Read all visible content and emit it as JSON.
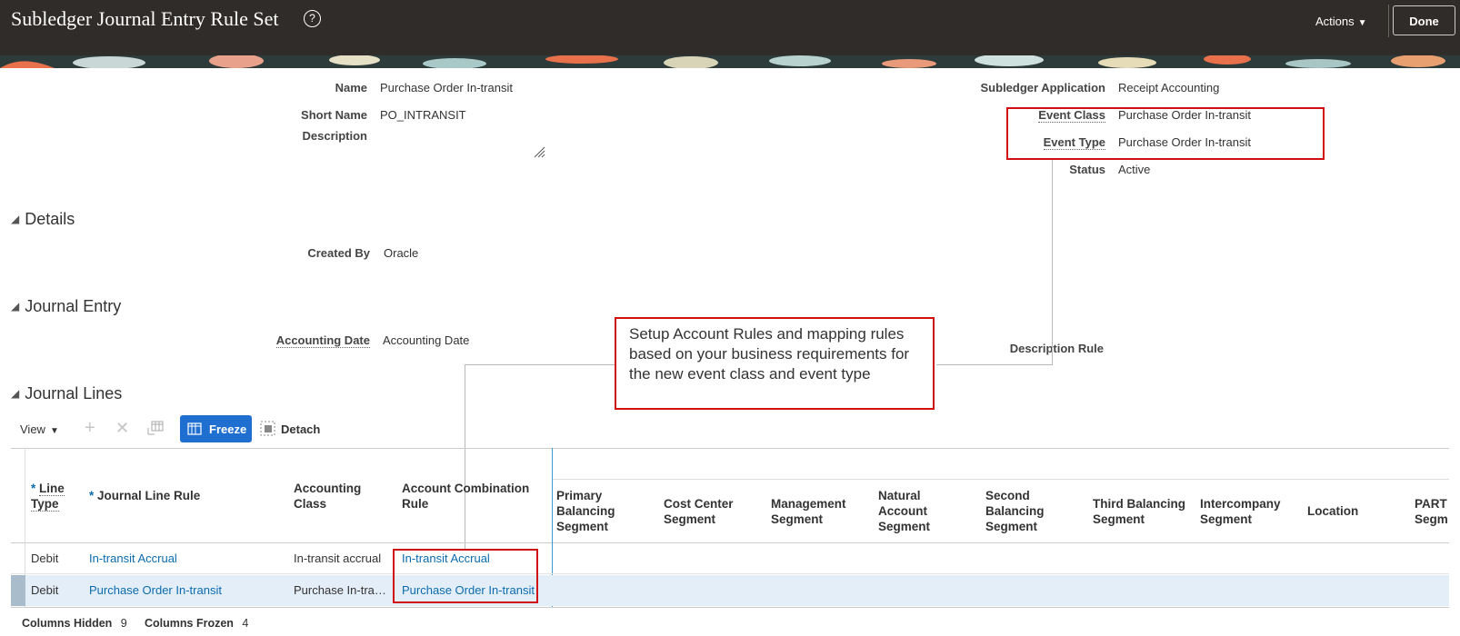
{
  "header": {
    "title": "Subledger Journal Entry Rule Set",
    "help_icon": "question-circle-icon",
    "actions_label": "Actions",
    "done_label": "Done"
  },
  "form": {
    "name_label": "Name",
    "name_value": "Purchase Order In-transit",
    "short_name_label": "Short Name",
    "short_name_value": "PO_INTRANSIT",
    "description_label": "Description",
    "description_value": "",
    "subledger_application_label": "Subledger Application",
    "subledger_application_value": "Receipt Accounting",
    "event_class_label": "Event Class",
    "event_class_value": "Purchase Order In-transit",
    "event_type_label": "Event Type",
    "event_type_value": "Purchase Order In-transit",
    "status_label": "Status",
    "status_value": "Active"
  },
  "details": {
    "title": "Details",
    "created_by_label": "Created By",
    "created_by_value": "Oracle"
  },
  "journal_entry": {
    "title": "Journal Entry",
    "accounting_date_label": "Accounting Date",
    "accounting_date_value": "Accounting Date",
    "description_rule_label": "Description Rule"
  },
  "callout": {
    "text": "Setup Account Rules and mapping rules based on your business requirements for the new event class and event type"
  },
  "journal_lines": {
    "title": "Journal Lines",
    "toolbar": {
      "view_label": "View",
      "add_icon": "plus-icon",
      "delete_icon": "x-icon",
      "columns_icon": "table-columns-icon",
      "freeze_label": "Freeze",
      "detach_label": "Detach"
    },
    "columns": {
      "line_type": "Line Type",
      "journal_line_rule": "Journal Line Rule",
      "accounting_class": "Accounting Class",
      "account_combination_rule": "Account Combination Rule",
      "primary_balancing_segment": "Primary Balancing Segment",
      "cost_center_segment": "Cost Center Segment",
      "management_segment": "Management Segment",
      "natural_account_segment": "Natural Account Segment",
      "second_balancing_segment": "Second Balancing Segment",
      "third_balancing_segment": "Third Balancing Segment",
      "intercompany_segment": "Intercompany Segment",
      "location": "Location",
      "partial": "PART Segm"
    },
    "rows": [
      {
        "line_type": "Debit",
        "journal_line_rule": "In-transit Accrual",
        "accounting_class": "In-transit accrual",
        "account_combination_rule": "In-transit Accrual"
      },
      {
        "line_type": "Debit",
        "journal_line_rule": "Purchase Order In-transit",
        "accounting_class": "Purchase In-tra…",
        "account_combination_rule": "Purchase Order In-transit"
      }
    ],
    "footer": {
      "columns_hidden_label": "Columns Hidden",
      "columns_hidden_value": "9",
      "columns_frozen_label": "Columns Frozen",
      "columns_frozen_value": "4"
    }
  },
  "colors": {
    "header_bg": "#302c29",
    "accent_blue": "#1f6fd1",
    "link_blue": "#0a6cad",
    "highlight_red": "#d01010",
    "selected_row": "#e4eef8"
  }
}
